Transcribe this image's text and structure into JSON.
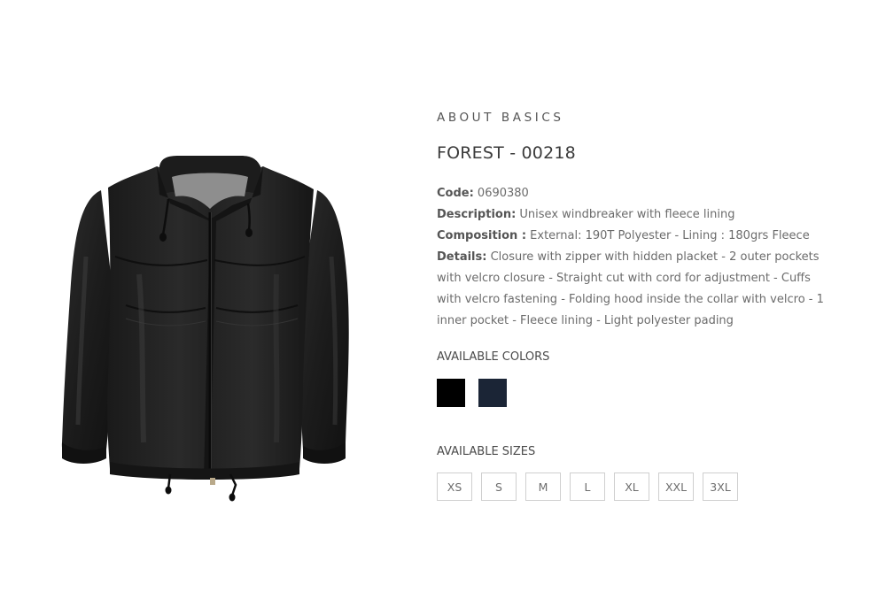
{
  "product": {
    "brand": "ABOUT BASICS",
    "title": "FOREST - 00218",
    "specs": {
      "code_label": "Code:",
      "code_value": " 0690380",
      "description_label": "Description:",
      "description_value": " Unisex windbreaker with fleece lining",
      "composition_label": "Composition :",
      "composition_value": " External: 190T Polyester - Lining : 180grs Fleece",
      "details_label": "Details:",
      "details_value": " Closure with zipper with hidden placket - 2 outer pockets with velcro closure - Straight cut with cord for adjustment - Cuffs with velcro fastening - Folding hood inside the collar with velcro - 1 inner pocket - Fleece lining - Light polyester pading"
    },
    "image_icon": "black-windbreaker-jacket-photo"
  },
  "colors": {
    "label": "AVAILABLE COLORS",
    "swatches": [
      {
        "hex": "#000000"
      },
      {
        "hex": "#1b2536"
      }
    ]
  },
  "sizes": {
    "label": "AVAILABLE SIZES",
    "options": [
      "XS",
      "S",
      "M",
      "L",
      "XL",
      "XXL",
      "3XL"
    ]
  }
}
